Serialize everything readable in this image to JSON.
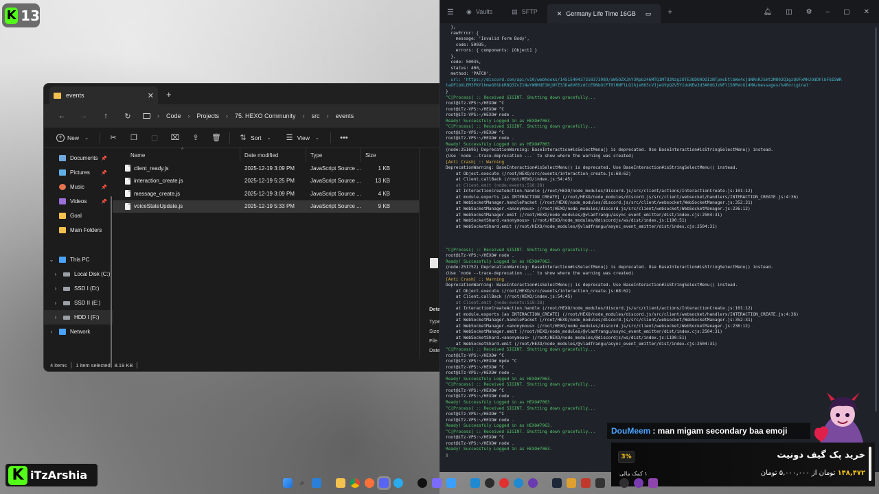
{
  "overlay": {
    "kick_badge_number": "13",
    "streamer_name": "iTzArshia"
  },
  "explorer": {
    "tab_title": "events",
    "breadcrumb": [
      "Code",
      "Projects",
      "75. HEXO Community",
      "src",
      "events"
    ],
    "toolbar": {
      "new": "New",
      "sort": "Sort",
      "view": "View"
    },
    "sidebar": {
      "quick": [
        {
          "label": "Documents",
          "color": "#6fa8dc"
        },
        {
          "label": "Pictures",
          "color": "#5fb0e8"
        },
        {
          "label": "Music",
          "color": "#e8734f"
        },
        {
          "label": "Videos",
          "color": "#9b6fd8"
        },
        {
          "label": "Goal",
          "color": "#f2c14e"
        },
        {
          "label": "Main Folders",
          "color": "#f2c14e"
        }
      ],
      "this_pc": "This PC",
      "drives": [
        "Local Disk (C:)",
        "SSD I (D:)",
        "SSD II (E:)",
        "HDD I (F:)"
      ],
      "network": "Network"
    },
    "columns": {
      "name": "Name",
      "date": "Date modified",
      "type": "Type",
      "size": "Size"
    },
    "files": [
      {
        "name": "client_ready.js",
        "date": "2025-12-19 3:09 PM",
        "type": "JavaScript Source ...",
        "size": "1 KB"
      },
      {
        "name": "interaction_create.js",
        "date": "2025-12-19 5:25 PM",
        "type": "JavaScript Source ...",
        "size": "13 KB"
      },
      {
        "name": "message_create.js",
        "date": "2025-12-19 3:09 PM",
        "type": "JavaScript Source ...",
        "size": "4 KB"
      },
      {
        "name": "voiceStateUpdate.js",
        "date": "2025-12-19 5:33 PM",
        "type": "JavaScript Source ...",
        "size": "9 KB"
      }
    ],
    "details_labels": [
      "Deta",
      "Type",
      "Size",
      "File",
      "Date"
    ],
    "status": {
      "items": "4 items",
      "selected": "1 item selected",
      "size": "8.19 KB"
    }
  },
  "terminal": {
    "tabs": [
      {
        "label": "Vaults",
        "icon": "vault-icon"
      },
      {
        "label": "SFTP",
        "icon": "sftp-icon"
      },
      {
        "label": "Germany Life Time 16GB",
        "icon": "close-icon"
      }
    ],
    "lines": [
      {
        "c": "w",
        "t": "  },"
      },
      {
        "c": "w",
        "t": "  rawError: {"
      },
      {
        "c": "w",
        "t": "    message: 'Invalid Form Body',"
      },
      {
        "c": "w",
        "t": "    code: 50035,"
      },
      {
        "c": "w",
        "t": "    errors: { components: [Object] }"
      },
      {
        "c": "w",
        "t": "  },"
      },
      {
        "c": "w",
        "t": "  code: 50035,"
      },
      {
        "c": "w",
        "t": "  status: 400,"
      },
      {
        "c": "w",
        "t": "  method: 'PATCH',"
      },
      {
        "c": "cy",
        "t": "  url: 'https://discord.com/api/v10/webhooks/1451540437310373989/aW5OZXJhY3Rpb246MTQ1MTU2Nzg2OTE3ODU0OOIzNTpmcEtlbWx4cjdNRnRJSmt2MU02Q1gzQUFxMHJOdDhlbF8ISWR"
      },
      {
        "c": "cy",
        "t": "taOF1bXLEM3FKY1hmeG01bkR8Q3ZvZ1NwYWNHUE1WjNYZ3JDa6V6SzdCcE9NbGtFT0lHNFlLQ1hje063cVJjeGVpQ2V5Y1duNEw3d3A0dGJzNFl1S0RVcG14MA/messages/%40original'"
      },
      {
        "c": "w",
        "t": "}"
      },
      {
        "c": "g",
        "t": "^C[Process] :: Received SIGINT. Shutting down gracefully..."
      },
      {
        "c": "w",
        "t": "root@iTz-VPS:~/HEXO# ^C"
      },
      {
        "c": "w",
        "t": "root@iTz-VPS:~/HEXO# ^C"
      },
      {
        "c": "w",
        "t": "root@iTz-VPS:~/HEXO# node ."
      },
      {
        "c": "g",
        "t": "Ready! Successfuly Logged in as HEXO#7063."
      },
      {
        "c": "g",
        "t": "^C[Process] :: Received SIGINT. Shutting down gracefully..."
      },
      {
        "c": "w",
        "t": "root@iTz-VPS:~/HEXO# ^C"
      },
      {
        "c": "w",
        "t": "root@iTz-VPS:~/HEXO# node ."
      },
      {
        "c": "g",
        "t": "Ready! Successfuly Logged in as HEXO#7063."
      },
      {
        "c": "w",
        "t": "(node:251695) DeprecationWarning: BaseInteraction#isSelectMenu() is deprecated. Use BaseInteraction#isStringSelectMenu() instead."
      },
      {
        "c": "w",
        "t": "(Use `node --trace-deprecation ...` to show where the warning was created)"
      },
      {
        "c": "y",
        "t": "[Anti Crash] :: Warning"
      },
      {
        "c": "w",
        "t": "DeprecationWarning: BaseInteraction#isSelectMenu() is deprecated. Use BaseInteraction#isStringSelectMenu() instead."
      },
      {
        "c": "w",
        "t": "    at Object.execute (/root/HEXO/src/events/interaction_create.js:68:62)"
      },
      {
        "c": "w",
        "t": "    at Client.callBack (/root/HEXO/index.js:54:45)"
      },
      {
        "c": "gr",
        "t": "    at Client.emit (node:events:518:28)"
      },
      {
        "c": "w",
        "t": "    at InteractionCreateAction.handle (/root/HEXO/node_modules/discord.js/src/client/actions/InteractionCreate.js:101:12)"
      },
      {
        "c": "w",
        "t": "    at module.exports [as INTERACTION_CREATE] (/root/HEXO/node_modules/discord.js/src/client/websocket/handlers/INTERACTION_CREATE.js:4:36)"
      },
      {
        "c": "w",
        "t": "    at WebSocketManager.handlePacket (/root/HEXO/node_modules/discord.js/src/client/websocket/WebSocketManager.js:352:31)"
      },
      {
        "c": "w",
        "t": "    at WebSocketManager.<anonymous> (/root/HEXO/node_modules/discord.js/src/client/websocket/WebSocketManager.js:236:12)"
      },
      {
        "c": "w",
        "t": "    at WebSocketManager.emit (/root/HEXO/node_modules/@vladfrangu/async_event_emitter/dist/index.cjs:2504:31)"
      },
      {
        "c": "w",
        "t": "    at WebSocketShard.<anonymous> (/root/HEXO/node_modules/@discordjs/ws/dist/index.js:1190:51)"
      },
      {
        "c": "w",
        "t": "    at WebSocketShard.emit (/root/HEXO/node_modules/@vladfrangu/async_event_emitter/dist/index.cjs:2504:31)"
      },
      {
        "c": "w",
        "t": " "
      },
      {
        "c": "w",
        "t": " "
      },
      {
        "c": "w",
        "t": " "
      },
      {
        "c": "g",
        "t": "^C[Process] :: Received SIGINT. Shutting down gracefully..."
      },
      {
        "c": "w",
        "t": "root@iTz-VPS:~/HEXO# node ."
      },
      {
        "c": "g",
        "t": "Ready! Successfuly Logged in as HEXO#7063."
      },
      {
        "c": "w",
        "t": "(node:251752) DeprecationWarning: BaseInteraction#isSelectMenu() is deprecated. Use BaseInteraction#isStringSelectMenu() instead."
      },
      {
        "c": "w",
        "t": "(Use `node --trace-deprecation ...` to show where the warning was created)"
      },
      {
        "c": "y",
        "t": "[Anti Crash] :: Warning"
      },
      {
        "c": "w",
        "t": "DeprecationWarning: BaseInteraction#isSelectMenu() is deprecated. Use BaseInteraction#isStringSelectMenu() instead."
      },
      {
        "c": "w",
        "t": "    at Object.execute (/root/HEXO/src/events/interaction_create.js:68:62)"
      },
      {
        "c": "w",
        "t": "    at Client.callBack (/root/HEXO/index.js:54:45)"
      },
      {
        "c": "gr",
        "t": "    at Client.emit (node:events:518:28)"
      },
      {
        "c": "w",
        "t": "    at InteractionCreateAction.handle (/root/HEXO/node_modules/discord.js/src/client/actions/InteractionCreate.js:101:12)"
      },
      {
        "c": "w",
        "t": "    at module.exports [as INTERACTION_CREATE] (/root/HEXO/node_modules/discord.js/src/client/websocket/handlers/INTERACTION_CREATE.js:4:36)"
      },
      {
        "c": "w",
        "t": "    at WebSocketManager.handlePacket (/root/HEXO/node_modules/discord.js/src/client/websocket/WebSocketManager.js:352:31)"
      },
      {
        "c": "w",
        "t": "    at WebSocketManager.<anonymous> (/root/HEXO/node_modules/discord.js/src/client/websocket/WebSocketManager.js:236:12)"
      },
      {
        "c": "w",
        "t": "    at WebSocketManager.emit (/root/HEXO/node_modules/@vladfrangu/async_event_emitter/dist/index.cjs:2504:31)"
      },
      {
        "c": "w",
        "t": "    at WebSocketShard.<anonymous> (/root/HEXO/node_modules/@discordjs/ws/dist/index.js:1190:51)"
      },
      {
        "c": "w",
        "t": "    at WebSocketShard.emit (/root/HEXO/node_modules/@vladfrangu/async_event_emitter/dist/index.cjs:2504:31)"
      },
      {
        "c": "g",
        "t": "^C[Process] :: Received SIGINT. Shutting down gracefully..."
      },
      {
        "c": "w",
        "t": "root@iTz-VPS:~/HEXO# ^C"
      },
      {
        "c": "w",
        "t": "root@iTz-VPS:~/HEXO# mpde ^C"
      },
      {
        "c": "w",
        "t": "root@iTz-VPS:~/HEXO# ^C"
      },
      {
        "c": "w",
        "t": "root@iTz-VPS:~/HEXO# node ."
      },
      {
        "c": "g",
        "t": "Ready! Successfuly Logged in as HEXO#7063."
      },
      {
        "c": "g",
        "t": "^C[Process] :: Received SIGINT. Shutting down gracefully..."
      },
      {
        "c": "w",
        "t": "root@iTz-VPS:~/HEXO# ^C"
      },
      {
        "c": "w",
        "t": "root@iTz-VPS:~/HEXO# node ."
      },
      {
        "c": "g",
        "t": "Ready! Successfuly Logged in as HEXO#7063."
      },
      {
        "c": "g",
        "t": "^C[Process] :: Received SIGINT. Shutting down gracefully..."
      },
      {
        "c": "w",
        "t": "root@iTz-VPS:~/HEXO# ^C"
      },
      {
        "c": "w",
        "t": "root@iTz-VPS:~/HEXO# node ."
      },
      {
        "c": "g",
        "t": "Ready! Successfuly Logged in as HEXO#7063."
      },
      {
        "c": "g",
        "t": "^C[Process] :: Received SIGINT. Shutting down gracefully..."
      },
      {
        "c": "w",
        "t": "root@iTz-VPS:~/HEXO# ^C"
      },
      {
        "c": "w",
        "t": "root@iTz-VPS:~/HEXO# node ."
      },
      {
        "c": "g",
        "t": "Ready! Successfuly Logged in as HEXO#7063."
      },
      {
        "c": "w",
        "t": "▯"
      }
    ]
  },
  "chat": {
    "user": "DouMeem",
    "message": ": man migam secondary baa emoji"
  },
  "donation": {
    "title": "خرید پک گیف دونیت",
    "amount_prefix": "تومان از ۵,۰۰۰,۰۰۰ تومان",
    "amount_current": "۱۴۸,۴۷۲",
    "percent": "3%",
    "helpers": "۱ کمک مالی"
  },
  "colors": {
    "kick_green": "#53fc18",
    "terminal_green": "#56c26a",
    "terminal_warning": "#e0b24a",
    "chat_username": "#4aa3ff",
    "donation_highlight": "#f5c518"
  }
}
